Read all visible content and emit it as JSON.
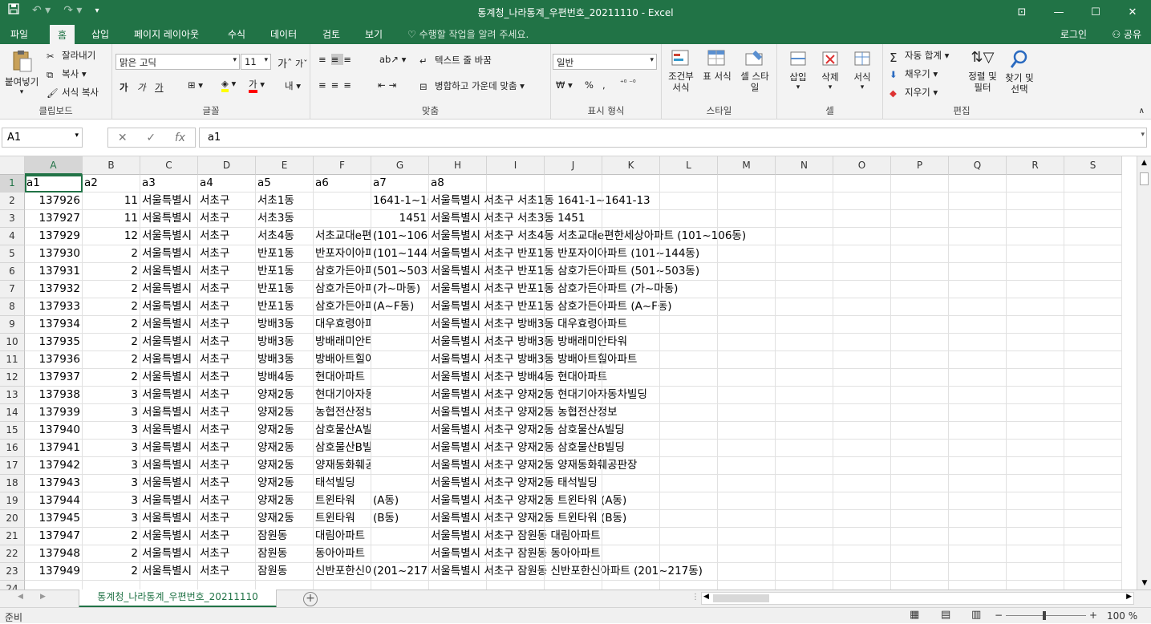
{
  "window": {
    "title": "통계청_나라통계_우편번호_20211110 - Excel"
  },
  "quick_access": {
    "save_icon": "save-icon",
    "undo_icon": "undo-icon",
    "redo_icon": "redo-icon"
  },
  "tabs": [
    "파일",
    "홈",
    "삽입",
    "페이지 레이아웃",
    "수식",
    "데이터",
    "검토",
    "보기"
  ],
  "active_tab": "홈",
  "tell_me": "수행할 작업을 알려 주세요.",
  "login": "로그인",
  "share": "공유",
  "ribbon": {
    "clipboard": {
      "paste": "붙여넣기",
      "cut": "잘라내기",
      "copy": "복사",
      "format_painter": "서식 복사",
      "label": "클립보드"
    },
    "font": {
      "name": "맑은 고딕",
      "size": "11",
      "bold": "가",
      "italic": "가",
      "underline": "가",
      "label": "글꼴"
    },
    "alignment": {
      "wrap": "텍스트 줄 바꿈",
      "merge": "병합하고 가운데 맞춤",
      "label": "맞춤"
    },
    "number": {
      "format": "일반",
      "percent": "%",
      "comma": ",",
      "label": "표시 형식"
    },
    "styles": {
      "conditional": "조건부 서식",
      "table": "표 서식",
      "cell": "셀 스타일",
      "label": "스타일"
    },
    "cells": {
      "insert": "삽입",
      "delete": "삭제",
      "format": "서식",
      "label": "셀"
    },
    "editing": {
      "autosum": "자동 합계",
      "fill": "채우기",
      "clear": "지우기",
      "sort": "정렬 및 필터",
      "find": "찾기 및 선택",
      "label": "편집"
    }
  },
  "formula_bar": {
    "name_box": "A1",
    "cancel": "✕",
    "enter": "✓",
    "fx": "fx",
    "value": "a1"
  },
  "columns": [
    "A",
    "B",
    "C",
    "D",
    "E",
    "F",
    "G",
    "H",
    "I",
    "J",
    "K",
    "L",
    "M",
    "N",
    "O",
    "P",
    "Q",
    "R",
    "S"
  ],
  "rows": [
    [
      "a1",
      "a2",
      "a3",
      "a4",
      "a5",
      "a6",
      "a7",
      "a8"
    ],
    [
      "137926",
      "11",
      "서울특별시",
      "서초구",
      "서초1동",
      "",
      "1641-1~1641-13",
      "서울특별시 서초구 서초1동 1641-1~1641-13"
    ],
    [
      "137927",
      "11",
      "서울특별시",
      "서초구",
      "서초3동",
      "",
      "1451",
      "서울특별시 서초구 서초3동 1451"
    ],
    [
      "137929",
      "12",
      "서울특별시",
      "서초구",
      "서초4동",
      "서초교대e편한세상아파트",
      "(101~106동)",
      "서울특별시 서초구 서초4동 서초교대e편한세상아파트 (101~106동)"
    ],
    [
      "137930",
      "2",
      "서울특별시",
      "서초구",
      "반포1동",
      "반포자이아파트",
      "(101~144동)",
      "서울특별시 서초구 반포1동 반포자이아파트 (101~144동)"
    ],
    [
      "137931",
      "2",
      "서울특별시",
      "서초구",
      "반포1동",
      "삼호가든아파트",
      "(501~503동)",
      "서울특별시 서초구 반포1동 삼호가든아파트 (501~503동)"
    ],
    [
      "137932",
      "2",
      "서울특별시",
      "서초구",
      "반포1동",
      "삼호가든아파트",
      "(가~마동)",
      "서울특별시 서초구 반포1동 삼호가든아파트 (가~마동)"
    ],
    [
      "137933",
      "2",
      "서울특별시",
      "서초구",
      "반포1동",
      "삼호가든아파트",
      "(A~F동)",
      "서울특별시 서초구 반포1동 삼호가든아파트 (A~F동)"
    ],
    [
      "137934",
      "2",
      "서울특별시",
      "서초구",
      "방배3동",
      "대우효령아파트",
      "",
      "서울특별시 서초구 방배3동 대우효령아파트"
    ],
    [
      "137935",
      "2",
      "서울특별시",
      "서초구",
      "방배3동",
      "방배래미안타워",
      "",
      "서울특별시 서초구 방배3동 방배래미안타워"
    ],
    [
      "137936",
      "2",
      "서울특별시",
      "서초구",
      "방배3동",
      "방배아트힐아파트",
      "",
      "서울특별시 서초구 방배3동 방배아트힐아파트"
    ],
    [
      "137937",
      "2",
      "서울특별시",
      "서초구",
      "방배4동",
      "현대아파트",
      "",
      "서울특별시 서초구 방배4동 현대아파트"
    ],
    [
      "137938",
      "3",
      "서울특별시",
      "서초구",
      "양재2동",
      "현대기아자동차빌딩",
      "",
      "서울특별시 서초구 양재2동 현대기아자동차빌딩"
    ],
    [
      "137939",
      "3",
      "서울특별시",
      "서초구",
      "양재2동",
      "농협전산정보",
      "",
      "서울특별시 서초구 양재2동 농협전산정보"
    ],
    [
      "137940",
      "3",
      "서울특별시",
      "서초구",
      "양재2동",
      "삼호물산A빌딩",
      "",
      "서울특별시 서초구 양재2동 삼호물산A빌딩"
    ],
    [
      "137941",
      "3",
      "서울특별시",
      "서초구",
      "양재2동",
      "삼호물산B빌딩",
      "",
      "서울특별시 서초구 양재2동 삼호물산B빌딩"
    ],
    [
      "137942",
      "3",
      "서울특별시",
      "서초구",
      "양재2동",
      "양재동화훼공판장",
      "",
      "서울특별시 서초구 양재2동 양재동화훼공판장"
    ],
    [
      "137943",
      "3",
      "서울특별시",
      "서초구",
      "양재2동",
      "태석빌딩",
      "",
      "서울특별시 서초구 양재2동 태석빌딩"
    ],
    [
      "137944",
      "3",
      "서울특별시",
      "서초구",
      "양재2동",
      "트윈타워",
      "(A동)",
      "서울특별시 서초구 양재2동 트윈타워 (A동)"
    ],
    [
      "137945",
      "3",
      "서울특별시",
      "서초구",
      "양재2동",
      "트윈타워",
      "(B동)",
      "서울특별시 서초구 양재2동 트윈타워 (B동)"
    ],
    [
      "137947",
      "2",
      "서울특별시",
      "서초구",
      "잠원동",
      "대림아파트",
      "",
      "서울특별시 서초구 잠원동 대림아파트"
    ],
    [
      "137948",
      "2",
      "서울특별시",
      "서초구",
      "잠원동",
      "동아아파트",
      "",
      "서울특별시 서초구 잠원동 동아아파트"
    ],
    [
      "137949",
      "2",
      "서울특별시",
      "서초구",
      "잠원동",
      "신반포한신아파트",
      "(201~217동)",
      "서울특별시 서초구 잠원동 신반포한신아파트 (201~217동)"
    ]
  ],
  "sheet_tab": "통계청_나라통계_우편번호_20211110",
  "status": {
    "ready": "준비",
    "zoom": "100 %"
  }
}
